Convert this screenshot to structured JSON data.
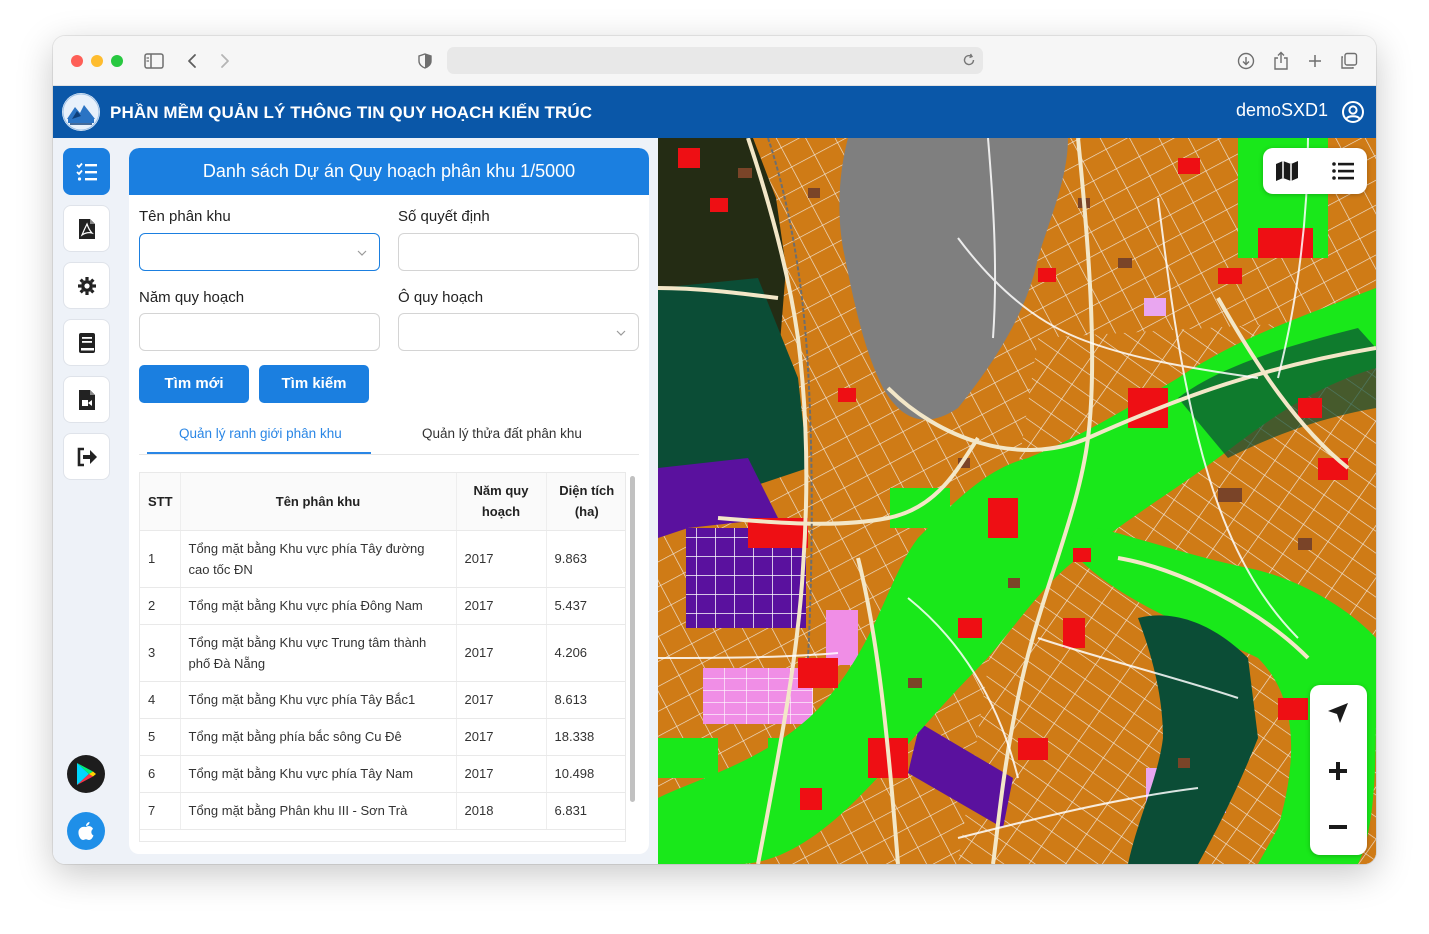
{
  "app": {
    "title": "PHẦN MỀM QUẢN LÝ THÔNG TIN QUY HOẠCH KIẾN TRÚC",
    "username": "demoSXD1"
  },
  "colors": {
    "header_blue": "#0a57a8",
    "accent_blue": "#1b7fe0",
    "map_residential": "#cf7b16",
    "map_park": "#19e81a",
    "map_water": "#7f7f7f",
    "map_industrial": "#5a119e",
    "map_commercial": "#ee0f14"
  },
  "browser": {
    "icons": [
      "sidebar-toggle-icon",
      "back-icon",
      "forward-icon",
      "shield-icon",
      "reload-icon",
      "download-icon",
      "share-icon",
      "new-tab-icon",
      "tab-overview-icon"
    ]
  },
  "sidebar": {
    "items": [
      {
        "icon": "list-check-icon",
        "active": true
      },
      {
        "icon": "pdf-file-icon",
        "active": false
      },
      {
        "icon": "gear-icon",
        "active": false
      },
      {
        "icon": "book-icon",
        "active": false
      },
      {
        "icon": "video-file-icon",
        "active": false
      },
      {
        "icon": "logout-icon",
        "active": false
      }
    ],
    "store_icons": [
      "google-play-icon",
      "app-store-icon"
    ]
  },
  "panel": {
    "title": "Danh sách Dự án Quy hoạch phân khu 1/5000",
    "fields": {
      "ten_phan_khu": {
        "label": "Tên phân khu",
        "value": ""
      },
      "so_quyet_dinh": {
        "label": "Số quyết định",
        "value": ""
      },
      "nam_quy_hoach": {
        "label": "Năm quy hoạch",
        "value": ""
      },
      "o_quy_hoach": {
        "label": "Ô quy hoạch",
        "value": ""
      }
    },
    "buttons": {
      "reset": "Tìm mới",
      "search": "Tìm kiếm"
    },
    "tabs": [
      {
        "label": "Quản lý ranh giới phân khu",
        "active": true
      },
      {
        "label": "Quản lý thửa đất phân khu",
        "active": false
      }
    ],
    "table": {
      "headers": {
        "stt": "STT",
        "name": "Tên phân khu",
        "year_1": "Năm quy",
        "year_2": "hoạch",
        "area_1": "Diện tích",
        "area_2": "(ha)"
      },
      "rows": [
        {
          "stt": "1",
          "name": "Tổng mặt bằng Khu vực phía Tây đường cao tốc ĐN",
          "year": "2017",
          "area": "9.863"
        },
        {
          "stt": "2",
          "name": "Tổng mặt bằng Khu vực phía Đông Nam",
          "year": "2017",
          "area": "5.437"
        },
        {
          "stt": "3",
          "name": "Tổng mặt bằng Khu vực Trung tâm thành phố Đà Nẵng",
          "year": "2017",
          "area": "4.206"
        },
        {
          "stt": "4",
          "name": "Tổng mặt bằng Khu vực phía Tây Bắc1",
          "year": "2017",
          "area": "8.613"
        },
        {
          "stt": "5",
          "name": "Tổng mặt bằng phía bắc sông Cu Đê",
          "year": "2017",
          "area": "18.338"
        },
        {
          "stt": "6",
          "name": "Tổng mặt bằng Khu vực phía Tây Nam",
          "year": "2017",
          "area": "10.498"
        },
        {
          "stt": "7",
          "name": "Tổng mặt bằng Phân khu III - Sơn Trà",
          "year": "2018",
          "area": "6.831"
        }
      ]
    }
  },
  "map": {
    "controls": [
      "map-icon",
      "layer-list-icon",
      "locate-arrow-icon",
      "zoom-in-icon",
      "zoom-out-icon"
    ]
  }
}
